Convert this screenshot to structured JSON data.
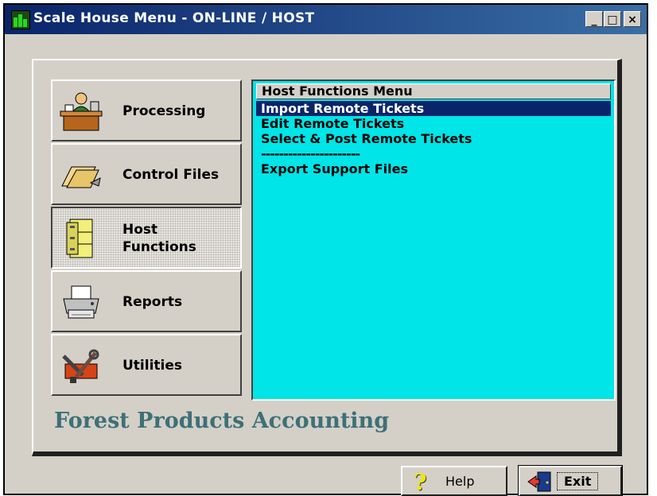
{
  "window": {
    "title": "Scale House Menu - ON-LINE / HOST",
    "minimize_label": "_",
    "maximize_label": "□",
    "close_label": "×"
  },
  "nav": {
    "items": [
      {
        "label": "Processing",
        "icon": "desk-person-icon"
      },
      {
        "label": "Control Files",
        "icon": "folder-icon"
      },
      {
        "label": "Host",
        "label2": "Functions",
        "icon": "filing-cabinet-icon"
      },
      {
        "label": "Reports",
        "icon": "printer-icon"
      },
      {
        "label": "Utilities",
        "icon": "tools-icon"
      }
    ],
    "active_index": 2
  },
  "menu": {
    "header": "Host Functions Menu",
    "items": [
      "Import Remote Tickets",
      "Edit Remote Tickets",
      "Select & Post Remote Tickets",
      "----------------------",
      "Export Support Files"
    ],
    "selected_index": 0
  },
  "brand": {
    "text": "Forest Products Accounting"
  },
  "buttons": {
    "help_label": "Help",
    "help_icon": "?",
    "exit_label": "Exit"
  },
  "colors": {
    "title_bar": "#0a246a",
    "menu_background": "#00e5e8",
    "selection": "#0a246a",
    "brand_text": "#3e7077"
  }
}
